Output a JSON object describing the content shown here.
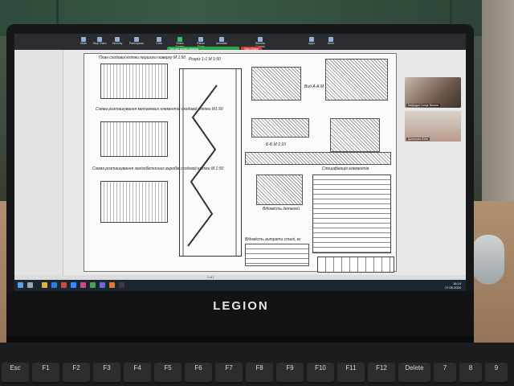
{
  "ribbon": {
    "items": [
      "Mute",
      "Stop Video",
      "Security",
      "Participants",
      "Chat",
      "Share Screen",
      "Pause Share",
      "Annotate",
      "Remote Control",
      "Apps",
      "More"
    ],
    "meeting_label": "You are screen sharing",
    "stop_label": "Stop Share"
  },
  "drawing": {
    "title_plan_1": "План сходової клітки першого поверху М 1:50",
    "title_section": "Розріз 1-1 М 1:50",
    "title_plan_2": "Схема розташування металевих елементів сходової клітки М1:50",
    "title_plan_3": "Схема розташування залізобетонних виробів сходової клітки М 1:50",
    "title_detail_a": "Вид А-А М 1:50",
    "title_detail_b": "Б-Б М 1:10",
    "title_spec": "Специфікація елементів",
    "title_vidomist": "Відомість деталей",
    "title_vidomist2": "Відомість витрати сталі, кг"
  },
  "participants": [
    {
      "name": "Кафедра Сонце Вишня"
    },
    {
      "name": "Дмитрова Юлія"
    }
  ],
  "status": {
    "page": "1 of 1"
  },
  "clock": {
    "time": "16:14",
    "date": "17.05.2024"
  },
  "brand": "LEGION",
  "keys": [
    "Esc",
    "F1",
    "F2",
    "F3",
    "F4",
    "F5",
    "F6",
    "F7",
    "F8",
    "F9",
    "F10",
    "F11",
    "F12",
    "Delete",
    "7",
    "8",
    "9"
  ]
}
